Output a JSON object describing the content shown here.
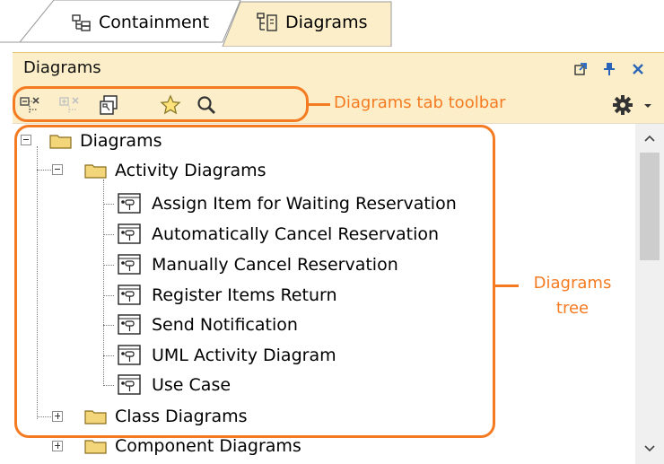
{
  "tabs": [
    {
      "label": "Containment",
      "icon": "containment-tree-icon",
      "active": false
    },
    {
      "label": "Diagrams",
      "icon": "diagrams-tab-icon",
      "active": true
    }
  ],
  "panel": {
    "title": "Diagrams",
    "header_buttons": [
      "float-icon",
      "pin-icon",
      "close-icon"
    ]
  },
  "toolbar": {
    "buttons": [
      {
        "icon": "collapse-all-icon",
        "enabled": true
      },
      {
        "icon": "expand-all-icon",
        "enabled": false
      },
      {
        "icon": "open-diagram-icon",
        "enabled": true
      },
      {
        "icon": "star-icon",
        "enabled": true
      },
      {
        "icon": "search-icon",
        "enabled": true
      }
    ],
    "options_icon": "gear-icon"
  },
  "callouts": {
    "toolbar": "Diagrams tab toolbar",
    "tree_line1": "Diagrams",
    "tree_line2": "tree"
  },
  "tree": {
    "root": "Diagrams",
    "groups": [
      {
        "label": "Activity Diagrams",
        "expanded": true,
        "children": [
          "Assign Item for Waiting Reservation",
          "Automatically Cancel Reservation",
          "Manually Cancel Reservation",
          "Register Items Return",
          "Send Notification",
          "UML Activity Diagram",
          "Use Case"
        ]
      },
      {
        "label": "Class Diagrams",
        "expanded": false,
        "children": []
      },
      {
        "label": "Component Diagrams",
        "expanded": false,
        "children": []
      }
    ]
  },
  "colors": {
    "accent": "#f47b22",
    "header_bg": "#fbeec8",
    "folder": "#f3d57a"
  }
}
